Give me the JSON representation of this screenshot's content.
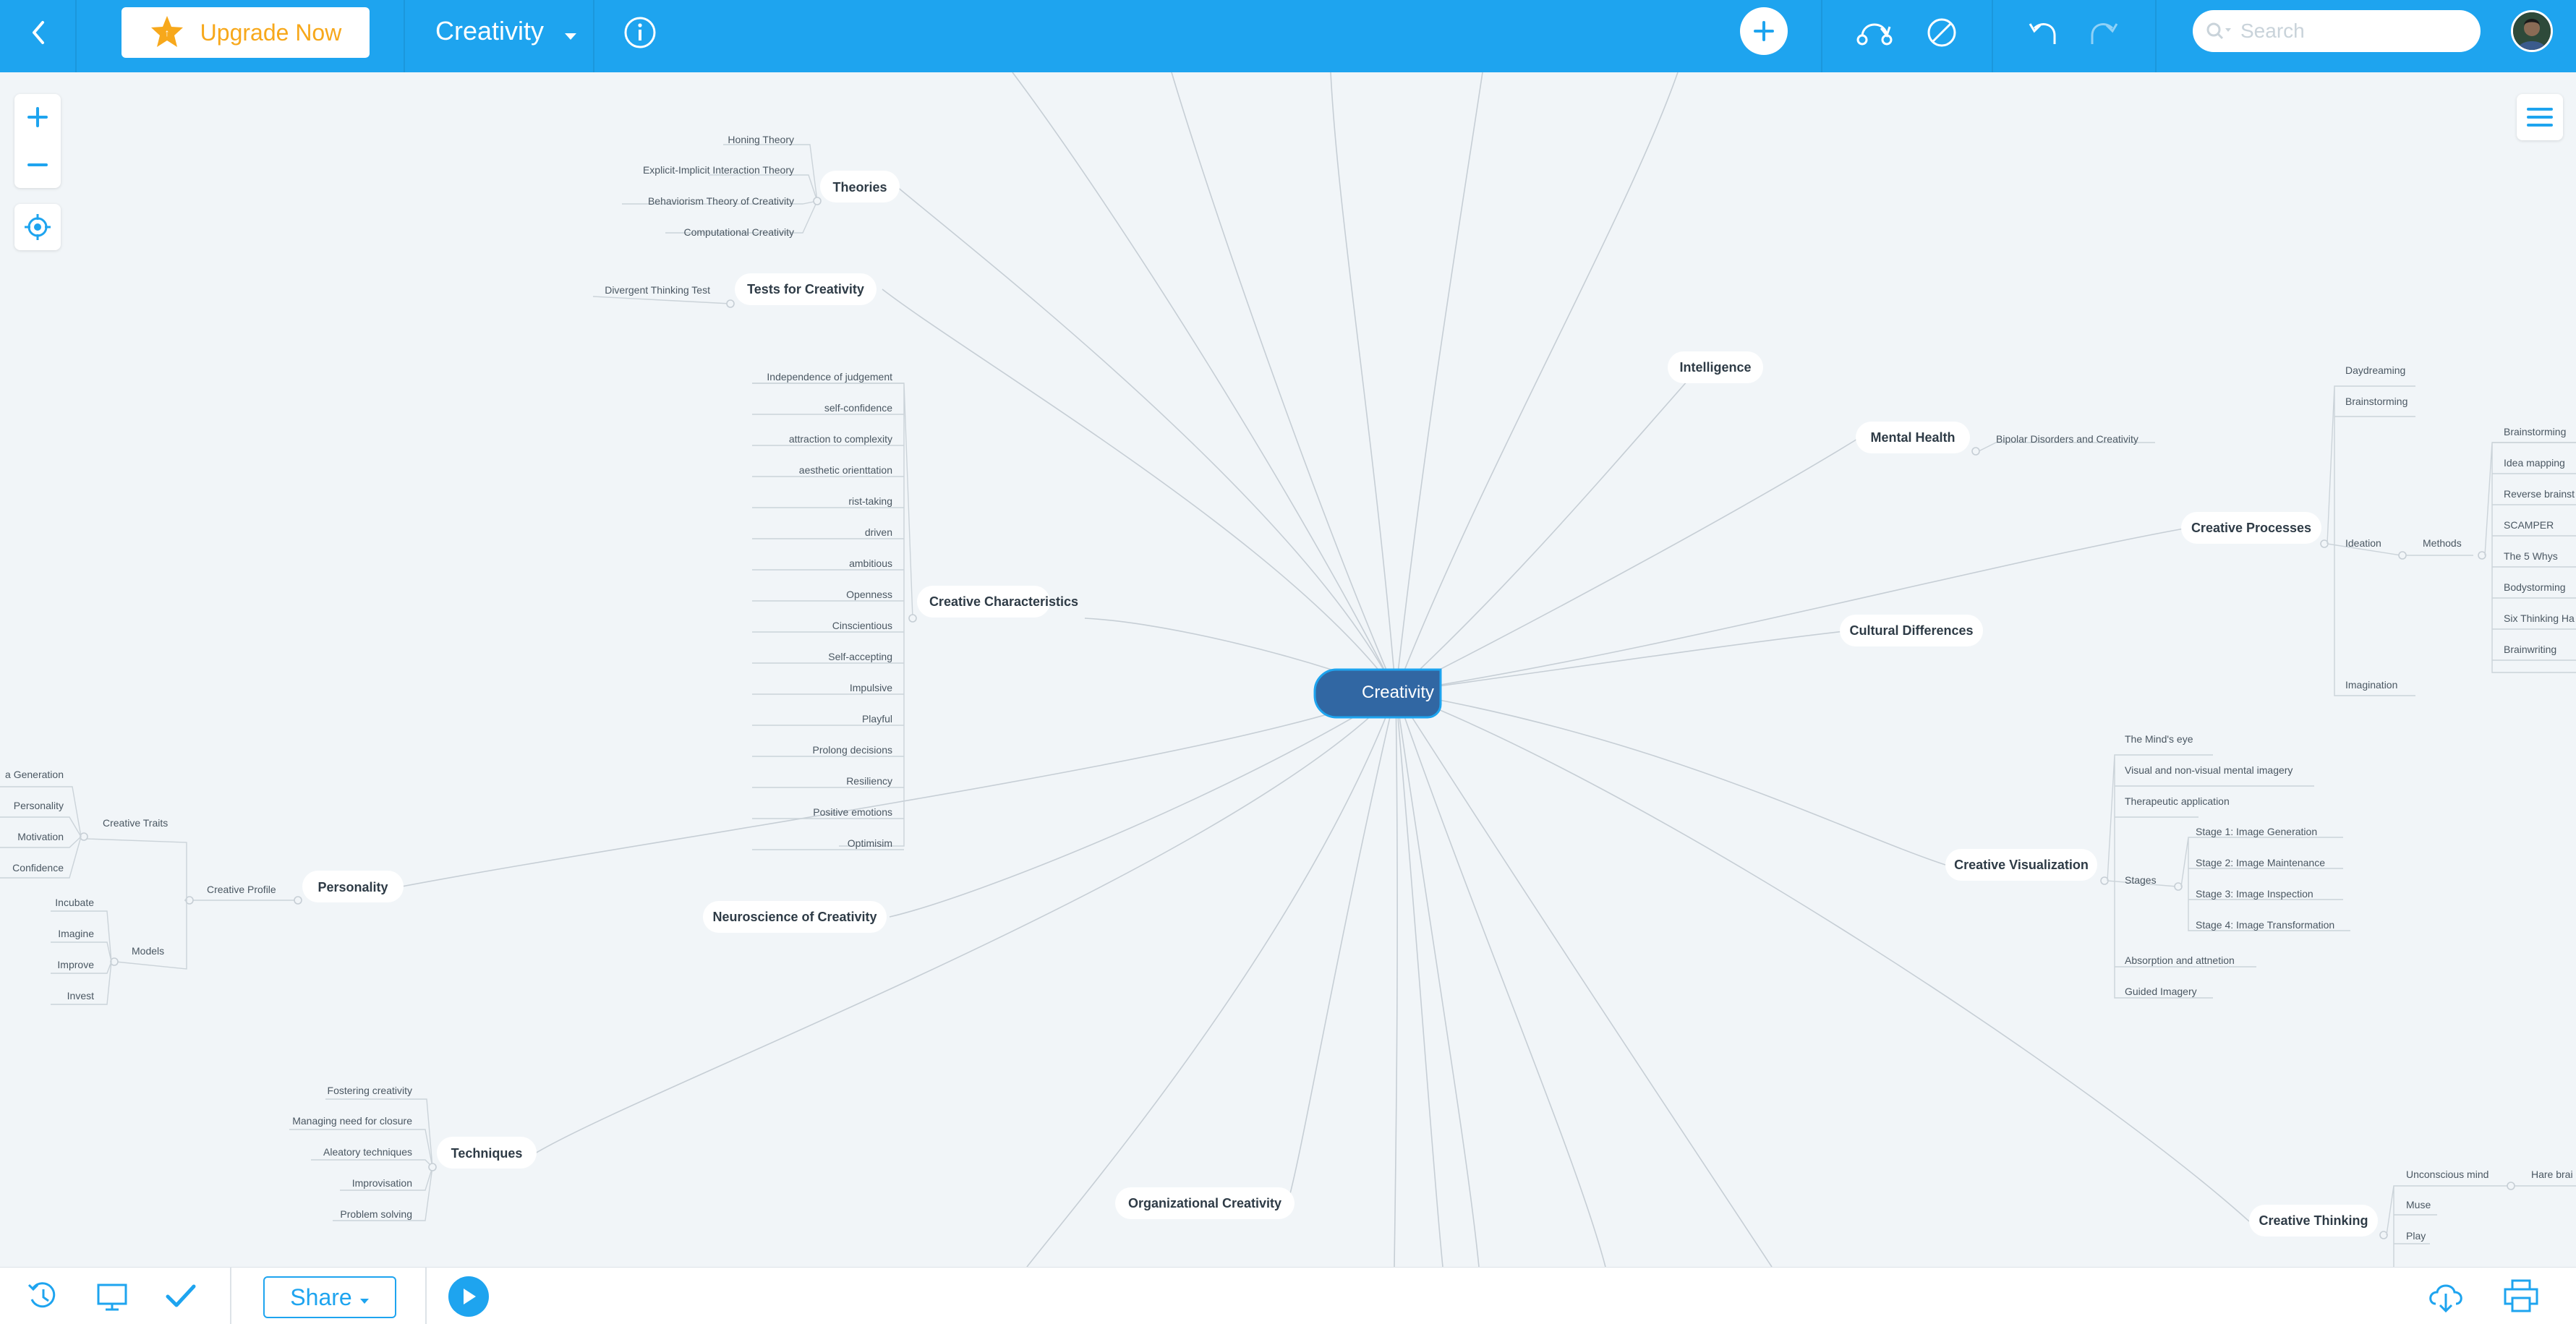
{
  "app": {
    "upgrade_label": "Upgrade Now",
    "doc_title": "Creativity",
    "search_placeholder": "Search",
    "share_label": "Share"
  },
  "colors": {
    "topbar": "#1ea4ef",
    "root_node": "#3167a3",
    "upgrade_text": "#f7a81b"
  },
  "icons": [
    "back-icon",
    "star-icon",
    "chevron-down-icon",
    "info-icon",
    "add-topic-icon",
    "relationship-icon",
    "boundary-icon",
    "undo-icon",
    "redo-icon",
    "search-icon",
    "zoom-in-icon",
    "zoom-out-icon",
    "locate-icon",
    "menu-icon",
    "history-icon",
    "presentation-icon",
    "checkmark-icon",
    "play-icon",
    "cloud-download-icon",
    "print-icon"
  ],
  "map": {
    "root": "Creativity",
    "nodes": {
      "theories": {
        "label": "Theories",
        "items": [
          "Honing Theory",
          "Explicit-Implicit Interaction Theory",
          "Behaviorism Theory of Creativity",
          "Computational Creativity"
        ]
      },
      "tests": {
        "label": "Tests for Creativity",
        "items": [
          "Divergent Thinking Test"
        ]
      },
      "characteristics": {
        "label": "Creative Characteristics",
        "items": [
          "Independence of judgement",
          "self-confidence",
          "attraction to complexity",
          "aesthetic orienttation",
          "rist-taking",
          "driven",
          "ambitious",
          "Openness",
          "Cinscientious",
          "Self-accepting",
          "Impulsive",
          "Playful",
          "Prolong decisions",
          "Resiliency",
          "Positive emotions",
          "Optimisim"
        ]
      },
      "personality": {
        "label": "Personality",
        "profile": "Creative Profile",
        "traits": "Creative Traits",
        "trait_items": [
          "a Generation",
          "Personality",
          "Motivation",
          "Confidence"
        ],
        "models": "Models",
        "model_items": [
          "Incubate",
          "Imagine",
          "Improve",
          "Invest"
        ]
      },
      "neuroscience": {
        "label": "Neuroscience of Creativity"
      },
      "techniques": {
        "label": "Techniques",
        "items": [
          "Fostering creativity",
          "Managing need for closure",
          "Aleatory techniques",
          "Improvisation",
          "Problem solving"
        ]
      },
      "organizational": {
        "label": "Organizational Creativity"
      },
      "intelligence": {
        "label": "Intelligence"
      },
      "mental_health": {
        "label": "Mental Health",
        "items": [
          "Bipolar Disorders and Creativity"
        ]
      },
      "processes": {
        "label": "Creative Processes",
        "items": [
          "Daydreaming",
          "Brainstorming",
          "Ideation",
          "Imagination"
        ],
        "methods": "Methods",
        "method_items": [
          "Brainstorming",
          "Idea mapping",
          "Reverse brainst",
          "SCAMPER",
          "The 5 Whys",
          "Bodystorming",
          "Six Thinking Ha",
          "Brainwriting"
        ]
      },
      "cultural": {
        "label": "Cultural Differences"
      },
      "visualization": {
        "label": "Creative Visualization",
        "items": [
          "The Mind's eye",
          "Visual and non-visual mental imagery",
          "Therapeutic application",
          "Stages",
          "Absorption and attnetion",
          "Guided Imagery"
        ],
        "stage_items": [
          "Stage 1: Image Generation",
          "Stage 2: Image Maintenance",
          "Stage 3: Image Inspection",
          "Stage 4: Image Transformation"
        ]
      },
      "thinking": {
        "label": "Creative Thinking",
        "items": [
          "Unconscious mind",
          "Muse",
          "Play"
        ],
        "extra": "Hare brai"
      }
    }
  }
}
